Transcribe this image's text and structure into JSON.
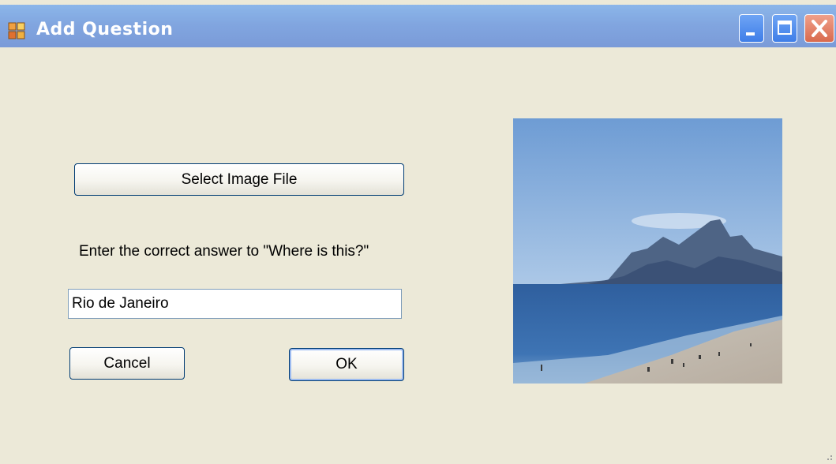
{
  "window": {
    "title": "Add Question"
  },
  "form": {
    "select_image_label": "Select Image File",
    "prompt_text": "Enter the correct answer to \"Where is this?\"",
    "answer_value": "Rio de Janeiro",
    "cancel_label": "Cancel",
    "ok_label": "OK"
  },
  "icons": {
    "app": "app-window-icon",
    "minimize": "minimize-icon",
    "maximize": "maximize-icon",
    "close": "close-icon",
    "resize": "resize-grip-icon"
  },
  "colors": {
    "background": "#ECE9D8",
    "titlebar": "#2A6FE6",
    "button_border": "#003C74"
  }
}
